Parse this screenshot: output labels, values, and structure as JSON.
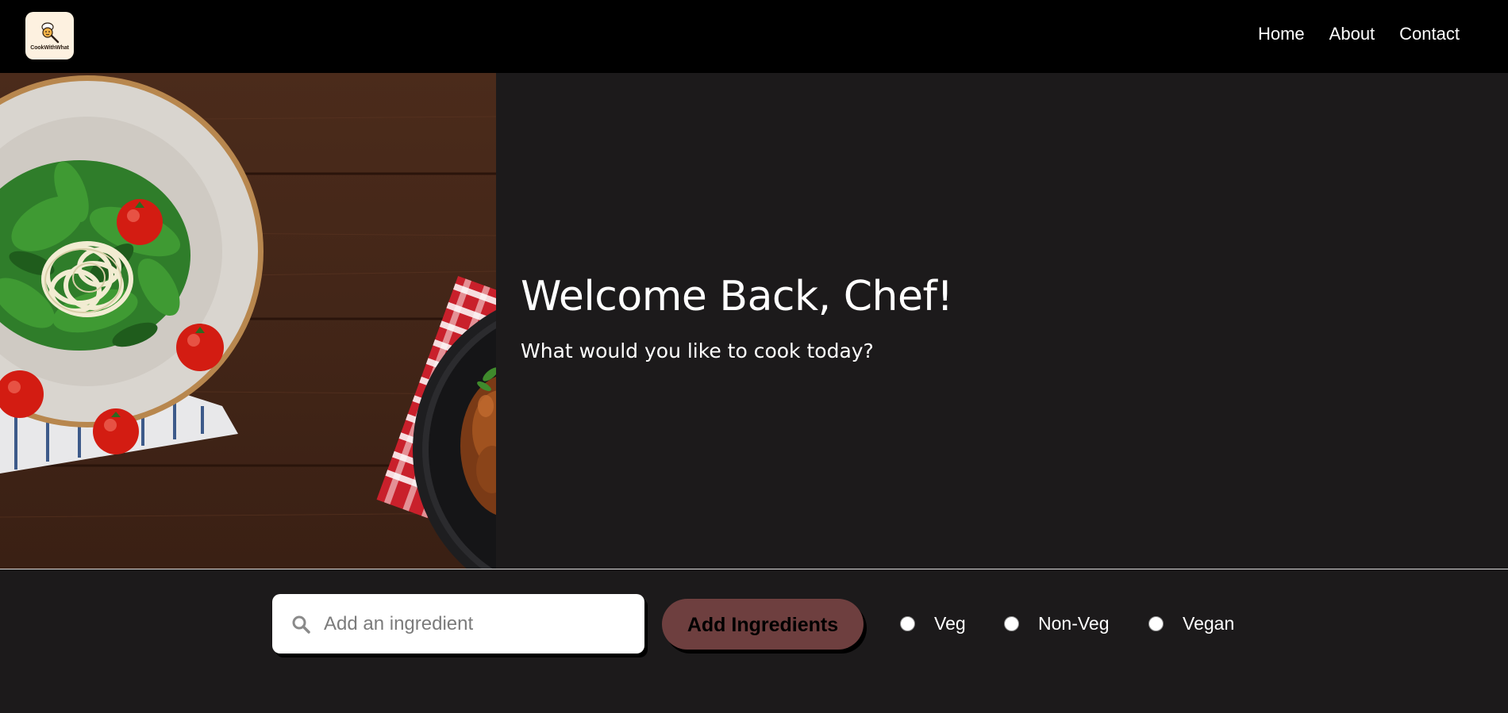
{
  "brand": {
    "logo_text": "CookWithWhat",
    "logo_icon": "chef-magnifier-icon"
  },
  "nav": {
    "items": [
      {
        "label": "Home"
      },
      {
        "label": "About"
      },
      {
        "label": "Contact"
      }
    ]
  },
  "hero": {
    "title": "Welcome Back, Chef!",
    "subtitle": "What would you like to cook today?",
    "image_description_icon": "food-photo"
  },
  "search": {
    "placeholder": "Add an ingredient",
    "value": "",
    "icon": "search-icon"
  },
  "actions": {
    "add_label": "Add Ingredients"
  },
  "diet_filters": [
    {
      "label": "Veg",
      "checked": false
    },
    {
      "label": "Non-Veg",
      "checked": false
    },
    {
      "label": "Vegan",
      "checked": false
    }
  ],
  "colors": {
    "background": "#1c1a1b",
    "navbar": "#000000",
    "button": "#6e3f3f",
    "logo_bg": "#fdf1e0"
  }
}
